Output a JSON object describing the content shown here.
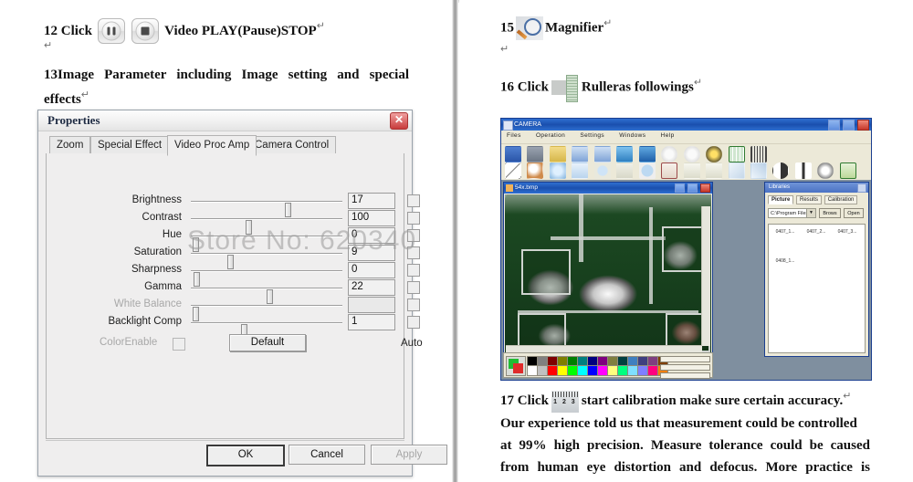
{
  "watermark": "Store No: 620340",
  "left_page": {
    "step12": {
      "number": "12 Click",
      "text": "Video PLAY(Pause)STOP",
      "pilcrow": "↵"
    },
    "pilcrow_a": "↵",
    "step13": {
      "line1": "13Image  Parameter  including  Image  setting  and  special",
      "line2": "effects",
      "pilcrow": "↵"
    },
    "icons": {
      "pause": "pause-icon",
      "stop": "stop-icon"
    }
  },
  "dialog": {
    "title": "Properties",
    "close_label": "✕",
    "tabs": [
      {
        "label": "Zoom",
        "active": false
      },
      {
        "label": "Special Effect",
        "active": false
      },
      {
        "label": "Video Proc Amp",
        "active": true
      },
      {
        "label": "Camera Control",
        "active": false
      }
    ],
    "sliders": [
      {
        "name": "Brightness",
        "value": "17",
        "pos": 62,
        "disabled": false,
        "auto": false
      },
      {
        "name": "Contrast",
        "value": "100",
        "pos": 36,
        "disabled": false,
        "auto": false
      },
      {
        "name": "Hue",
        "value": "0",
        "pos": 1,
        "disabled": false,
        "auto": false
      },
      {
        "name": "Saturation",
        "value": "9",
        "pos": 24,
        "disabled": false,
        "auto": false
      },
      {
        "name": "Sharpness",
        "value": "0",
        "pos": 2,
        "disabled": false,
        "auto": false
      },
      {
        "name": "Gamma",
        "value": "22",
        "pos": 50,
        "disabled": false,
        "auto": false
      },
      {
        "name": "White Balance",
        "value": "",
        "pos": 1,
        "disabled": true,
        "auto": false
      },
      {
        "name": "Backlight Comp",
        "value": "1",
        "pos": 33,
        "disabled": false,
        "auto": false
      }
    ],
    "color_enable_label": "ColorEnable",
    "default_label": "Default",
    "auto_label": "Auto",
    "buttons": {
      "ok": "OK",
      "cancel": "Cancel",
      "apply": "Apply"
    }
  },
  "right_page": {
    "step15": {
      "number": "15",
      "text": "Magnifier",
      "pilcrow": "↵",
      "icon": "magnifier-icon"
    },
    "pilcrow_b": "↵",
    "step16": {
      "number": "16 Click",
      "text": "Rulleras followings",
      "pilcrow": "↵",
      "icon": "ruler-icon"
    },
    "step17": {
      "number": "17 Click",
      "text": "start calibration make sure certain accuracy.",
      "pilcrow": "↵",
      "icon": "calibration-icon",
      "body_line1": "Our experience told us that measurement could be controlled",
      "body_line2": "at  99%  high  precision.  Measure  tolerance  could  be  caused",
      "body_line3": "from  human  eye  distortion  and  defocus.  More  practice  is"
    }
  },
  "app": {
    "title": "CAMERA",
    "window_buttons": {
      "minimize": "_",
      "maximize": "□",
      "close": "✕"
    },
    "menu": [
      "Files",
      "Operation",
      "Settings",
      "Windows",
      "Help"
    ],
    "toolbar_row1": [
      "screen-icon",
      "camera-icon",
      "folder-open-icon",
      "save-as-icon",
      "save-copy-icon",
      "refresh-icon",
      "save-icon",
      "pause-icon",
      "stop-icon",
      "record-icon",
      "grid-icon",
      "ruler-icon"
    ],
    "toolbar_row2": [
      "line-icon",
      "magnifier-icon",
      "circle-arc-icon",
      "rectangle-icon",
      "ellipse-icon",
      "polyline-icon",
      "filled-circle-icon",
      "angle-arc-icon",
      "point-label-icon",
      "distance-icon",
      "perpendicular-icon",
      "angle-icon",
      "contrast-icon",
      "split-icon",
      "brightness-icon",
      "calibrate-icon"
    ],
    "image_window": {
      "title": "54x.bmp"
    },
    "library": {
      "title": "Libraries",
      "tabs": [
        "Picture",
        "Results",
        "Calibration"
      ],
      "path": "C:\\Program Files",
      "browse_label": "Brows",
      "open_label": "Open",
      "files": [
        {
          "name": "0407_1...",
          "kind": "solid"
        },
        {
          "name": "0407_2...",
          "kind": "grid"
        },
        {
          "name": "0407_3...",
          "kind": "qr"
        },
        {
          "name": "0408_1...",
          "kind": "solid"
        }
      ]
    },
    "palette_colors_row1": [
      "#000000",
      "#808080",
      "#7f0000",
      "#7f7f00",
      "#007f00",
      "#007f7f",
      "#00007f",
      "#7f007f",
      "#7f7f3f",
      "#003f3f",
      "#3f7fbf",
      "#3f3f7f",
      "#7f3f7f",
      "#7f3f00"
    ],
    "palette_colors_row2": [
      "#ffffff",
      "#c0c0c0",
      "#ff0000",
      "#ffff00",
      "#00ff00",
      "#00ffff",
      "#0000ff",
      "#ff00ff",
      "#ffff7f",
      "#00ff7f",
      "#7fdfff",
      "#7f7fff",
      "#ff007f",
      "#ff7f00"
    ]
  }
}
